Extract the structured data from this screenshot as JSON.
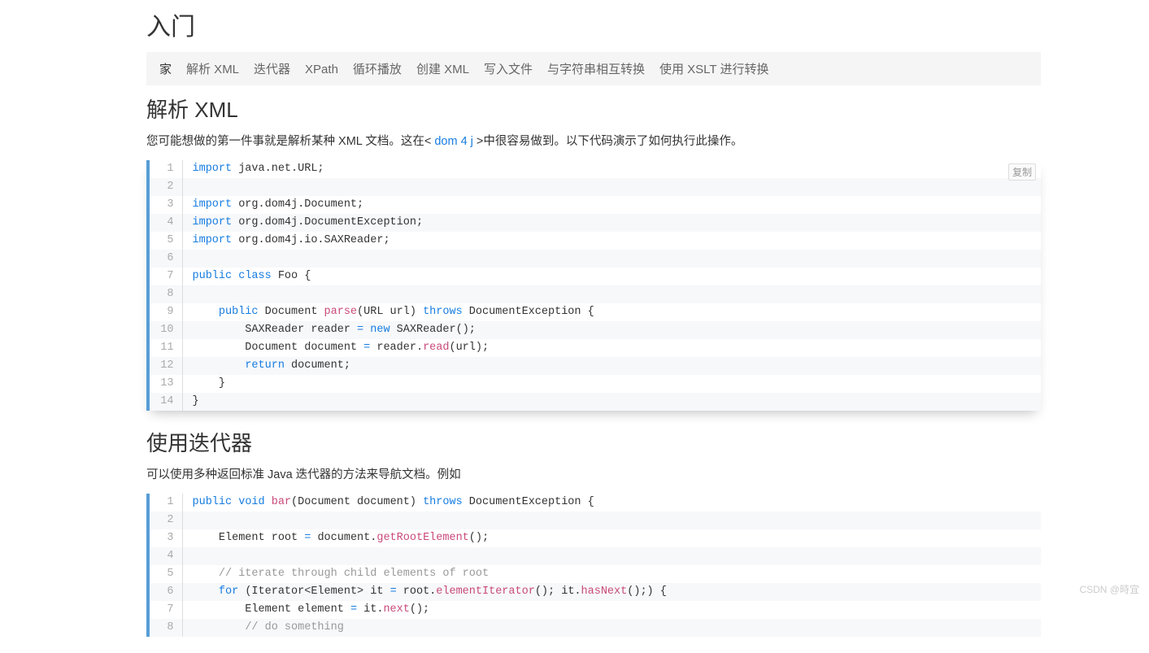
{
  "main_title": "入门",
  "nav": {
    "items": [
      "家",
      "解析 XML",
      "迭代器",
      "XPath",
      "循环播放",
      "创建 XML",
      "写入文件",
      "与字符串相互转换",
      "使用 XSLT 进行转换"
    ]
  },
  "copy_label": "复制",
  "section1": {
    "title": "解析 XML",
    "desc_before": "您可能想做的第一件事就是解析某种 XML 文档。这在",
    "desc_link_open": "< ",
    "desc_link": "dom 4 j",
    "desc_link_close": " >",
    "desc_after": "中很容易做到。以下代码演示了如何执行此操作。",
    "code": [
      {
        "ln": "1",
        "tokens": [
          [
            "kw",
            "import"
          ],
          [
            "",
            " java.net.URL;"
          ]
        ]
      },
      {
        "ln": "2",
        "tokens": [
          [
            "",
            ""
          ]
        ]
      },
      {
        "ln": "3",
        "tokens": [
          [
            "kw",
            "import"
          ],
          [
            "",
            " org.dom4j.Document;"
          ]
        ]
      },
      {
        "ln": "4",
        "tokens": [
          [
            "kw",
            "import"
          ],
          [
            "",
            " org.dom4j.DocumentException;"
          ]
        ]
      },
      {
        "ln": "5",
        "tokens": [
          [
            "kw",
            "import"
          ],
          [
            "",
            " org.dom4j.io.SAXReader;"
          ]
        ]
      },
      {
        "ln": "6",
        "tokens": [
          [
            "",
            ""
          ]
        ]
      },
      {
        "ln": "7",
        "tokens": [
          [
            "kw",
            "public"
          ],
          [
            "",
            " "
          ],
          [
            "kw",
            "class"
          ],
          [
            "",
            " Foo {"
          ]
        ]
      },
      {
        "ln": "8",
        "tokens": [
          [
            "",
            ""
          ]
        ]
      },
      {
        "ln": "9",
        "tokens": [
          [
            "",
            "    "
          ],
          [
            "kw",
            "public"
          ],
          [
            "",
            " Document "
          ],
          [
            "fn",
            "parse"
          ],
          [
            "",
            "(URL url) "
          ],
          [
            "kw",
            "throws"
          ],
          [
            "",
            " DocumentException {"
          ]
        ]
      },
      {
        "ln": "10",
        "tokens": [
          [
            "",
            "        SAXReader reader "
          ],
          [
            "kw",
            "="
          ],
          [
            "",
            " "
          ],
          [
            "kw",
            "new"
          ],
          [
            "",
            " SAXReader();"
          ]
        ]
      },
      {
        "ln": "11",
        "tokens": [
          [
            "",
            "        Document document "
          ],
          [
            "kw",
            "="
          ],
          [
            "",
            " reader."
          ],
          [
            "fn",
            "read"
          ],
          [
            "",
            "(url);"
          ]
        ]
      },
      {
        "ln": "12",
        "tokens": [
          [
            "",
            "        "
          ],
          [
            "kw",
            "return"
          ],
          [
            "",
            " document;"
          ]
        ]
      },
      {
        "ln": "13",
        "tokens": [
          [
            "",
            "    }"
          ]
        ]
      },
      {
        "ln": "14",
        "tokens": [
          [
            "",
            "}"
          ]
        ]
      }
    ]
  },
  "section2": {
    "title": "使用迭代器",
    "desc": "可以使用多种返回标准 Java 迭代器的方法来导航文档。例如",
    "code": [
      {
        "ln": "1",
        "tokens": [
          [
            "kw",
            "public"
          ],
          [
            "",
            " "
          ],
          [
            "kw",
            "void"
          ],
          [
            "",
            " "
          ],
          [
            "fn",
            "bar"
          ],
          [
            "",
            "(Document document) "
          ],
          [
            "kw",
            "throws"
          ],
          [
            "",
            " DocumentException {"
          ]
        ]
      },
      {
        "ln": "2",
        "tokens": [
          [
            "",
            ""
          ]
        ]
      },
      {
        "ln": "3",
        "tokens": [
          [
            "",
            "    Element root "
          ],
          [
            "kw",
            "="
          ],
          [
            "",
            " document."
          ],
          [
            "fn",
            "getRootElement"
          ],
          [
            "",
            "();"
          ]
        ]
      },
      {
        "ln": "4",
        "tokens": [
          [
            "",
            ""
          ]
        ]
      },
      {
        "ln": "5",
        "tokens": [
          [
            "",
            "    "
          ],
          [
            "cm",
            "// iterate through child elements of root"
          ]
        ]
      },
      {
        "ln": "6",
        "tokens": [
          [
            "",
            "    "
          ],
          [
            "kw",
            "for"
          ],
          [
            "",
            " (Iterator<Element> it "
          ],
          [
            "kw",
            "="
          ],
          [
            "",
            " root."
          ],
          [
            "fn",
            "elementIterator"
          ],
          [
            "",
            "(); it."
          ],
          [
            "fn",
            "hasNext"
          ],
          [
            "",
            "();) {"
          ]
        ]
      },
      {
        "ln": "7",
        "tokens": [
          [
            "",
            "        Element element "
          ],
          [
            "kw",
            "="
          ],
          [
            "",
            " it."
          ],
          [
            "fn",
            "next"
          ],
          [
            "",
            "();"
          ]
        ]
      },
      {
        "ln": "8",
        "tokens": [
          [
            "",
            "        "
          ],
          [
            "cm",
            "// do something"
          ]
        ]
      }
    ]
  },
  "watermark": "CSDN @時宜"
}
